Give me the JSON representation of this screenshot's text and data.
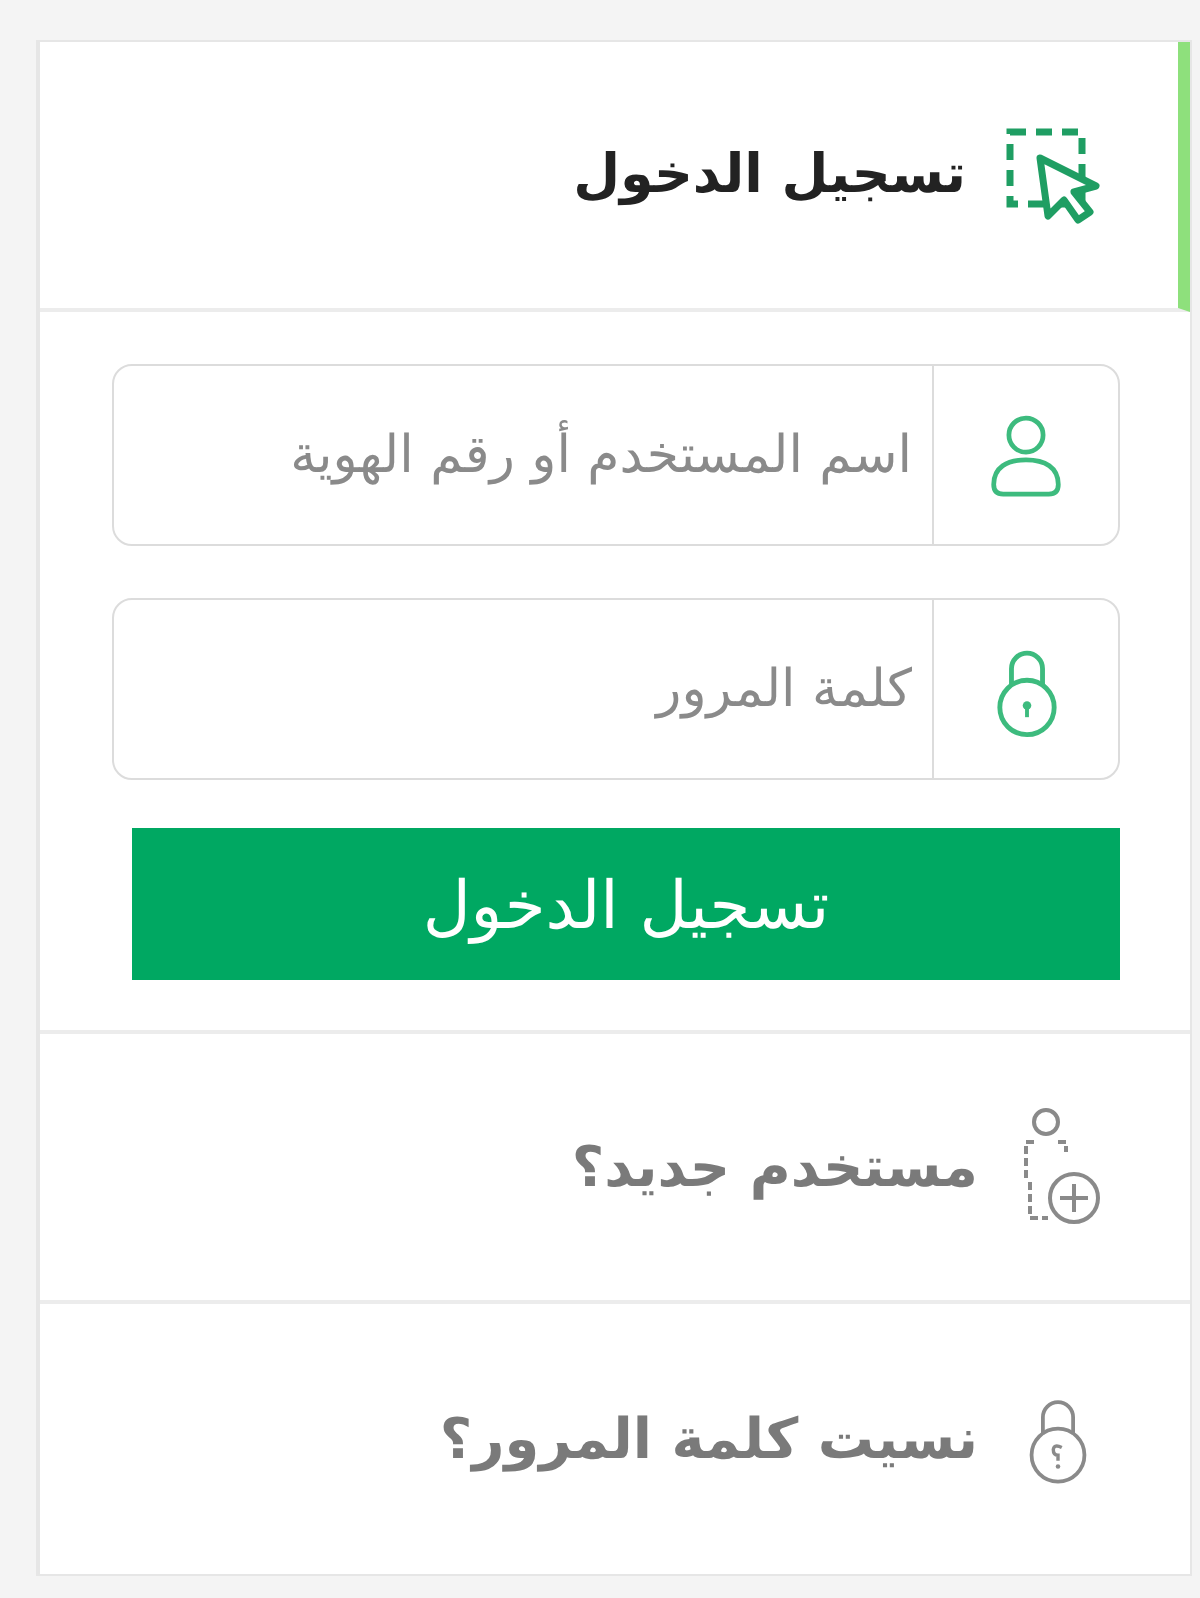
{
  "header": {
    "title": "تسجيل الدخول"
  },
  "fields": [
    {
      "kind": "user",
      "placeholder": "اسم المستخدم أو رقم الهوية"
    },
    {
      "kind": "lock",
      "placeholder": "كلمة المرور"
    }
  ],
  "submit_button": {
    "label": "تسجيل الدخول"
  },
  "links": [
    {
      "kind": "new-user",
      "label": "مستخدم جديد؟"
    },
    {
      "kind": "forgot-password",
      "label": "نسيت كلمة المرور؟"
    }
  ]
}
